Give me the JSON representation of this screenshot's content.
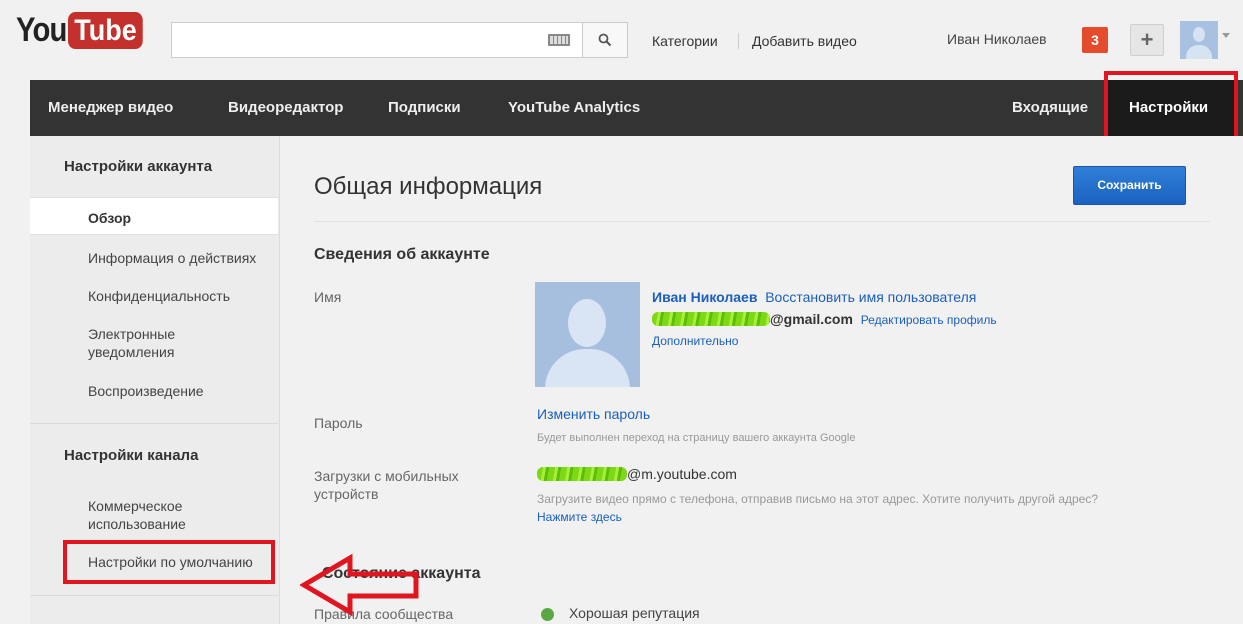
{
  "header": {
    "logo_you": "You",
    "logo_tube": "Tube",
    "search_placeholder": "",
    "categories_link": "Категории",
    "upload_link": "Добавить видео",
    "username": "Иван Николаев",
    "notifications_count": "3",
    "plus_label": "+"
  },
  "nav": {
    "items": [
      {
        "label": "Менеджер видео"
      },
      {
        "label": "Видеоредактор"
      },
      {
        "label": "Подписки"
      },
      {
        "label": "YouTube Analytics"
      }
    ],
    "inbox": "Входящие",
    "settings": "Настройки"
  },
  "sidebar": {
    "account_header": "Настройки аккаунта",
    "account_items": [
      {
        "label": "Обзор",
        "active": true
      },
      {
        "label": "Информация о действиях"
      },
      {
        "label": "Конфиденциальность"
      },
      {
        "label": "Электронные уведомления"
      },
      {
        "label": "Воспроизведение"
      }
    ],
    "channel_header": "Настройки канала",
    "channel_items": [
      {
        "label": "Коммерческое использование"
      },
      {
        "label": "Настройки по умолчанию"
      }
    ]
  },
  "main": {
    "title": "Общая информация",
    "save_button": "Сохранить",
    "account_section": "Сведения об аккаунте",
    "name_label": "Имя",
    "display_name": "Иван Николаев",
    "restore_username": "Восстановить имя пользователя",
    "email_suffix": "@gmail.com",
    "edit_profile": "Редактировать профиль",
    "more": "Дополнительно",
    "password_label": "Пароль",
    "change_password": "Изменить пароль",
    "password_hint": "Будет выполнен переход на страницу вашего аккаунта Google",
    "mobile_label": "Загрузки с мобильных устройств",
    "mobile_email_suffix": "@m.youtube.com",
    "mobile_hint": "Загрузите видео прямо с телефона, отправив письмо на этот адрес. Хотите получить другой адрес?",
    "click_here": "Нажмите здесь",
    "status_section": "Состояние аккаунта",
    "community_label": "Правила сообщества",
    "reputation": "Хорошая репутация"
  },
  "colors": {
    "annotation_red": "#e0151f",
    "save_blue": "#1b62c0",
    "link_blue": "#1a5fbd",
    "nav_dark": "#333333",
    "good_green": "#58a944"
  }
}
